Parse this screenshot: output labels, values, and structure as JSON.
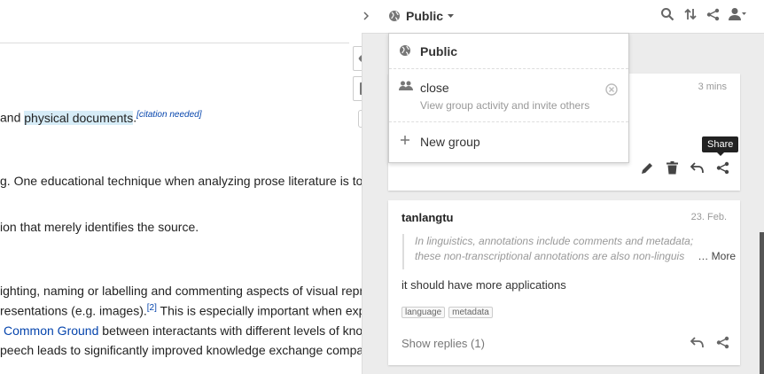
{
  "article": {
    "lines": [
      {
        "pre": "and ",
        "hl": "physical documents",
        "post": ".",
        "sup": "[citation needed]"
      },
      {
        "text": "g. One educational technique when analyzing prose literature is to h"
      },
      {
        "text": "ion that merely identifies the source."
      },
      {
        "text": "ighting, naming or labelling and commenting aspects of visual repres"
      },
      {
        "pre": "resentations (e.g. images).",
        "sup": "[2]",
        "post": " This is especially important when expe"
      },
      {
        "link": "Common Ground",
        "post": " between interactants with different levels of knowl"
      },
      {
        "text": "peech leads to significantly improved knowledge exchange compared"
      }
    ],
    "count_badge": "1"
  },
  "topbar": {
    "privacy_label": "Public",
    "icons": [
      "search-icon",
      "sort-icon",
      "share-icon",
      "user-icon"
    ]
  },
  "dropdown": {
    "items": [
      {
        "label": "Public",
        "icon": "globe-icon"
      },
      {
        "label": "close",
        "sub": "View group activity and invite others",
        "icon": "group-icon"
      },
      {
        "label": "New group",
        "icon": "plus-icon"
      }
    ]
  },
  "card1": {
    "timestamp": "3 mins",
    "tooltip": "Share"
  },
  "card2": {
    "user": "tanlangtu",
    "timestamp": "23. Feb.",
    "quote_line1": "In linguistics, annotations include comments and metadata;",
    "quote_line2": "these non-transcriptional annotations are also non-linguis",
    "more": "… More",
    "body": "it should have more applications",
    "tags": [
      "language",
      "metadata"
    ],
    "replies": "Show replies (1)"
  }
}
